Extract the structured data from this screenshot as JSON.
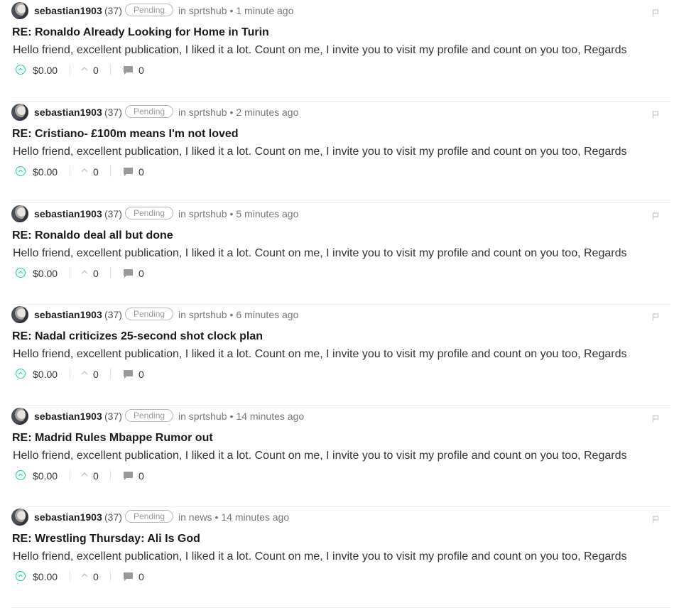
{
  "colors": {
    "accent": "#06d6a9",
    "title": "#1a1a1a",
    "meta": "#777777",
    "divider": "#eeeeee"
  },
  "icons": {
    "upvote": "chevron-up-circle-icon",
    "votes": "chevron-up-icon",
    "comments": "comment-icon",
    "flag": "flag-icon"
  },
  "comments": [
    {
      "author": "sebastian1903",
      "reputation": "(37)",
      "status": "Pending",
      "in_label": "in",
      "community": "sprtshub",
      "bullet": "•",
      "time": "1 minute ago",
      "title": "RE: Ronaldo Already Looking for Home in Turin",
      "body": "Hello friend, excellent publication, I liked it a lot. Count on me, I invite you to visit my profile and count on you too, Regards",
      "payout": "$0.00",
      "votes": "0",
      "replies": "0"
    },
    {
      "author": "sebastian1903",
      "reputation": "(37)",
      "status": "Pending",
      "in_label": "in",
      "community": "sprtshub",
      "bullet": "•",
      "time": "2 minutes ago",
      "title": "RE: Cristiano- £100m means I'm not loved",
      "body": "Hello friend, excellent publication, I liked it a lot. Count on me, I invite you to visit my profile and count on you too, Regards",
      "payout": "$0.00",
      "votes": "0",
      "replies": "0"
    },
    {
      "author": "sebastian1903",
      "reputation": "(37)",
      "status": "Pending",
      "in_label": "in",
      "community": "sprtshub",
      "bullet": "•",
      "time": "5 minutes ago",
      "title": "RE: Ronaldo deal all but done",
      "body": "Hello friend, excellent publication, I liked it a lot. Count on me, I invite you to visit my profile and count on you too, Regards",
      "payout": "$0.00",
      "votes": "0",
      "replies": "0"
    },
    {
      "author": "sebastian1903",
      "reputation": "(37)",
      "status": "Pending",
      "in_label": "in",
      "community": "sprtshub",
      "bullet": "•",
      "time": "6 minutes ago",
      "title": "RE: Nadal criticizes 25-second shot clock plan",
      "body": "Hello friend, excellent publication, I liked it a lot. Count on me, I invite you to visit my profile and count on you too, Regards",
      "payout": "$0.00",
      "votes": "0",
      "replies": "0"
    },
    {
      "author": "sebastian1903",
      "reputation": "(37)",
      "status": "Pending",
      "in_label": "in",
      "community": "sprtshub",
      "bullet": "•",
      "time": "14 minutes ago",
      "title": "RE: Madrid Rules Mbappe Rumor out",
      "body": "Hello friend, excellent publication, I liked it a lot. Count on me, I invite you to visit my profile and count on you too, Regards",
      "payout": "$0.00",
      "votes": "0",
      "replies": "0"
    },
    {
      "author": "sebastian1903",
      "reputation": "(37)",
      "status": "Pending",
      "in_label": "in",
      "community": "news",
      "bullet": "•",
      "time": "14 minutes ago",
      "title": "RE: Wrestling Thursday: Ali Is God",
      "body": "Hello friend, excellent publication, I liked it a lot. Count on me, I invite you to visit my profile and count on you too, Regards",
      "payout": "$0.00",
      "votes": "0",
      "replies": "0"
    }
  ]
}
